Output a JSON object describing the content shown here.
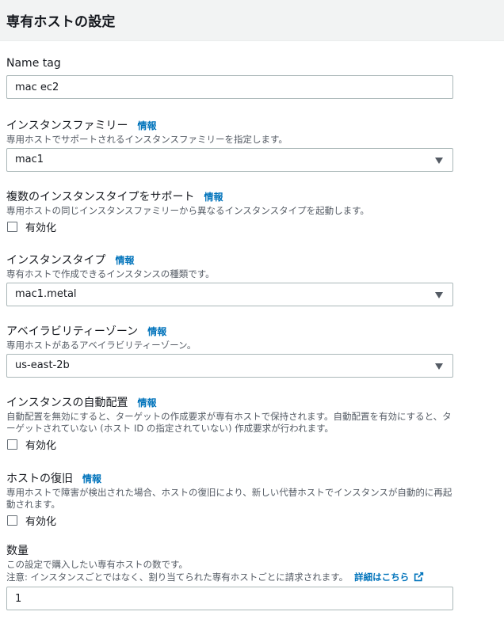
{
  "header": {
    "title": "専有ホストの設定"
  },
  "name_tag": {
    "label": "Name tag",
    "value": "mac ec2"
  },
  "instance_family": {
    "label": "インスタンスファミリー",
    "info": "情報",
    "description": "専用ホストでサポートされるインスタンスファミリーを指定します。",
    "selected": "mac1"
  },
  "multiple_types": {
    "label": "複数のインスタンスタイプをサポート",
    "info": "情報",
    "description": "専用ホストの同じインスタンスファミリーから異なるインスタンスタイプを起動します。",
    "checkbox_label": "有効化",
    "checked": false
  },
  "instance_type": {
    "label": "インスタンスタイプ",
    "info": "情報",
    "description": "専有ホストで作成できるインスタンスの種類です。",
    "selected": "mac1.metal"
  },
  "availability_zone": {
    "label": "アベイラビリティーゾーン",
    "info": "情報",
    "description": "専用ホストがあるアベイラビリティーゾーン。",
    "selected": "us-east-2b"
  },
  "auto_placement": {
    "label": "インスタンスの自動配置",
    "info": "情報",
    "description": "自動配置を無効にすると、ターゲットの作成要求が専有ホストで保持されます。自動配置を有効にすると、ターゲットされていない (ホスト ID の指定されていない) 作成要求が行われます。",
    "checkbox_label": "有効化",
    "checked": false
  },
  "host_recovery": {
    "label": "ホストの復旧",
    "info": "情報",
    "description": "専用ホストで障害が検出された場合、ホストの復旧により、新しい代替ホストでインスタンスが自動的に再起動されます。",
    "checkbox_label": "有効化",
    "checked": false
  },
  "quantity": {
    "label": "数量",
    "description": "この設定で購入したい専有ホストの数です。",
    "note": "注意: インスタンスごとではなく、割り当てられた専有ホストごとに請求されます。",
    "details_link": "詳細はこちら",
    "value": "1"
  },
  "colors": {
    "link": "#0073bb",
    "header_bg": "#f2f3f3",
    "border": "#aab7b8"
  },
  "icons": {
    "caret": "caret-down-icon",
    "external": "external-link-icon"
  }
}
